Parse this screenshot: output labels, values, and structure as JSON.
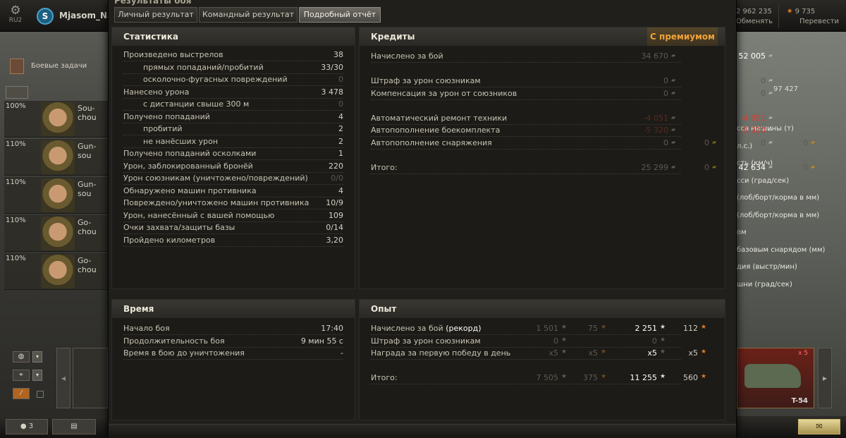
{
  "top": {
    "server": "RU2",
    "clan_tag": "S",
    "nickname": "Mjasom_Nar",
    "credits": "2 962 235",
    "exchange_label": "Обменять",
    "gold": "9 735",
    "transfer_label": "Перевести"
  },
  "left": {
    "tasks_label": "Боевые задачи",
    "crew": [
      {
        "pct": "100%",
        "name": "Sou-chou"
      },
      {
        "pct": "110%",
        "name": "Gun-sou"
      },
      {
        "pct": "110%",
        "name": "Gun-sou"
      },
      {
        "pct": "110%",
        "name": "Go-chou"
      },
      {
        "pct": "110%",
        "name": "Go-chou"
      }
    ],
    "bottom_count": "3"
  },
  "right": {
    "exp_value": "97 427",
    "params": [
      "сса машины (т)",
      "л.с.)",
      "сть (км/ч)",
      "сси (град/сек)",
      "(лоб/борт/корма в мм)",
      "(лоб/борт/корма в мм)",
      "ом",
      "базовым снарядом (мм)",
      "дия (выстр/мин)",
      "шни (град/сек)"
    ],
    "tank_name": "T-54",
    "tank_mult": "x 5"
  },
  "window": {
    "title": "Результаты боя",
    "tabs": [
      "Личный результат",
      "Командный результат",
      "Подробный отчёт"
    ],
    "active_tab": 2,
    "stats": {
      "header": "Статистика",
      "rows": [
        {
          "label": "Произведено выстрелов",
          "value": "38",
          "indent": false,
          "dim": false
        },
        {
          "label": "прямых попаданий/пробитий",
          "value": "33/30",
          "indent": true,
          "dim": false
        },
        {
          "label": "осколочно-фугасных повреждений",
          "value": "0",
          "indent": true,
          "dim": true
        },
        {
          "label": "Нанесено урона",
          "value": "3 478",
          "indent": false,
          "dim": false
        },
        {
          "label": "с дистанции свыше 300 м",
          "value": "0",
          "indent": true,
          "dim": true
        },
        {
          "label": "Получено попаданий",
          "value": "4",
          "indent": false,
          "dim": false
        },
        {
          "label": "пробитий",
          "value": "2",
          "indent": true,
          "dim": false
        },
        {
          "label": "не нанёсших урон",
          "value": "2",
          "indent": true,
          "dim": false
        },
        {
          "label": "Получено попаданий осколками",
          "value": "1",
          "indent": false,
          "dim": false
        },
        {
          "label": "Урон, заблокированный бронёй",
          "value": "220",
          "indent": false,
          "dim": false
        },
        {
          "label": "Урон союзникам (уничтожено/повреждений)",
          "value": "0/0",
          "indent": false,
          "dim": true
        },
        {
          "label": "Обнаружено машин противника",
          "value": "4",
          "indent": false,
          "dim": false
        },
        {
          "label": "Повреждено/уничтожено машин противника",
          "value": "10/9",
          "indent": false,
          "dim": false
        },
        {
          "label": "Урон, нанесённый с вашей помощью",
          "value": "109",
          "indent": false,
          "dim": false
        },
        {
          "label": "Очки захвата/защиты базы",
          "value": "0/14",
          "indent": false,
          "dim": false
        },
        {
          "label": "Пройдено километров",
          "value": "3,20",
          "indent": false,
          "dim": false
        }
      ]
    },
    "credits": {
      "header": "Кредиты",
      "premium_header": "С премиумом",
      "rows": [
        {
          "label": "Начислено за бой",
          "base": "34 670",
          "prem": "52 005",
          "base_g": "",
          "prem_g": "",
          "style": "normal"
        },
        {
          "label": "",
          "base": "",
          "prem": "",
          "base_g": "",
          "prem_g": "",
          "style": "gap"
        },
        {
          "label": "Штраф за урон союзникам",
          "base": "0",
          "prem": "0",
          "base_g": "",
          "prem_g": "",
          "style": "dim"
        },
        {
          "label": "Компенсация за урон от союзников",
          "base": "0",
          "prem": "0",
          "base_g": "",
          "prem_g": "",
          "style": "dim"
        },
        {
          "label": "",
          "base": "",
          "prem": "",
          "base_g": "",
          "prem_g": "",
          "style": "gap"
        },
        {
          "label": "Автоматический ремонт техники",
          "base": "-4 051",
          "prem": "-4 051",
          "base_g": "",
          "prem_g": "",
          "style": "red"
        },
        {
          "label": "Автопополнение боекомплекта",
          "base": "-5 320",
          "prem": "-5 320",
          "base_g": "",
          "prem_g": "",
          "style": "red"
        },
        {
          "label": "Автопополнение снаряжения",
          "base": "0",
          "prem": "0",
          "base_g": "0",
          "prem_g": "0",
          "style": "dim"
        },
        {
          "label": "",
          "base": "",
          "prem": "",
          "base_g": "",
          "prem_g": "",
          "style": "gap"
        },
        {
          "label": "Итого:",
          "base": "25 299",
          "prem": "42 634",
          "base_g": "0",
          "prem_g": "0",
          "style": "total"
        }
      ]
    },
    "time": {
      "header": "Время",
      "rows": [
        {
          "label": "Начало боя",
          "value": "17:40"
        },
        {
          "label": "Продолжительность боя",
          "value": "9 мин 55 с"
        },
        {
          "label": "Время в бою до уничтожения",
          "value": "-"
        }
      ]
    },
    "exp": {
      "header": "Опыт",
      "rows": [
        {
          "label": "Начислено за бой",
          "label_extra": "(рекорд)",
          "base": "1 501",
          "base_f": "75",
          "prem": "2 251",
          "prem_f": "112"
        },
        {
          "label": "Штраф за урон союзникам",
          "label_extra": "",
          "base": "0",
          "base_f": "",
          "prem": "0",
          "prem_f": ""
        },
        {
          "label": "Награда за первую победу в день",
          "label_extra": "",
          "base": "x5",
          "base_f": "x5",
          "prem": "x5",
          "prem_f": "x5"
        },
        {
          "label": "",
          "label_extra": "",
          "base": "",
          "base_f": "",
          "prem": "",
          "prem_f": ""
        },
        {
          "label": "Итого:",
          "label_extra": "",
          "base": "7 505",
          "base_f": "375",
          "prem": "11 255",
          "prem_f": "560"
        }
      ]
    }
  }
}
